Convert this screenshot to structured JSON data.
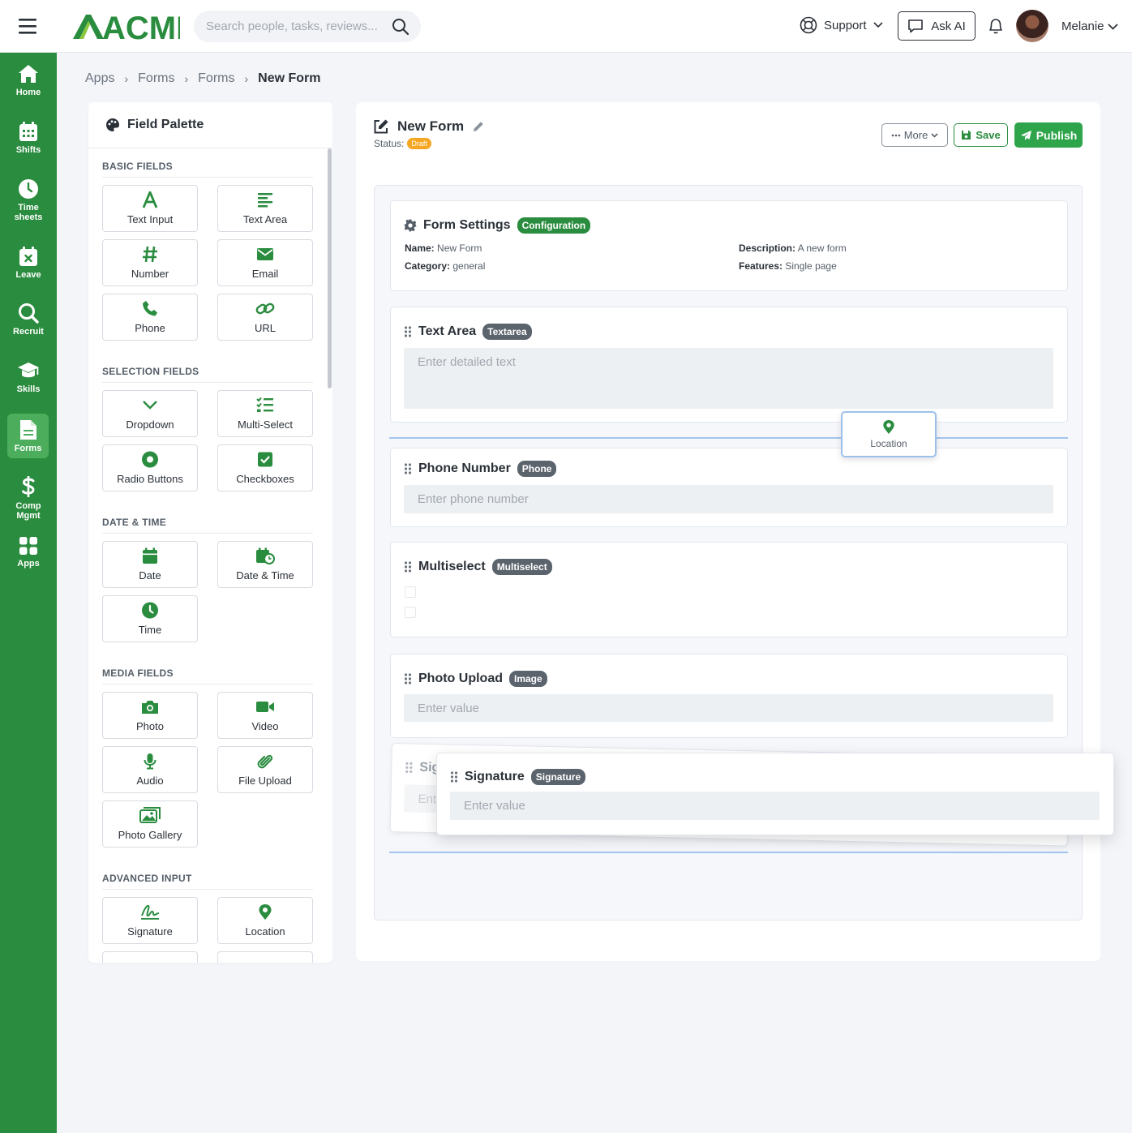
{
  "header": {
    "logo_text": "ACME",
    "search_placeholder": "Search people, tasks, reviews...",
    "support_label": "Support",
    "ask_ai_label": "Ask AI",
    "user_name": "Melanie"
  },
  "sidebar": {
    "items": [
      {
        "label": "Home",
        "icon": "home-icon"
      },
      {
        "label": "Shifts",
        "icon": "calendar-icon"
      },
      {
        "label": "Time\nsheets",
        "icon": "clock-icon"
      },
      {
        "label": "Leave",
        "icon": "calendar-x-icon"
      },
      {
        "label": "Recruit",
        "icon": "search-icon"
      },
      {
        "label": "Skills",
        "icon": "graduation-cap-icon"
      },
      {
        "label": "Forms",
        "icon": "document-icon",
        "active": true
      },
      {
        "label": "Comp\nMgmt",
        "icon": "dollar-icon"
      },
      {
        "label": "Apps",
        "icon": "apps-grid-icon"
      }
    ]
  },
  "breadcrumb": [
    "Apps",
    "Forms",
    "Forms",
    "New Form"
  ],
  "palette": {
    "title": "Field Palette",
    "sections": [
      {
        "title": "BASIC FIELDS",
        "items": [
          "Text Input",
          "Text Area",
          "Number",
          "Email",
          "Phone",
          "URL"
        ]
      },
      {
        "title": "SELECTION FIELDS",
        "items": [
          "Dropdown",
          "Multi-Select",
          "Radio Buttons",
          "Checkboxes"
        ]
      },
      {
        "title": "DATE & TIME",
        "items": [
          "Date",
          "Date & Time",
          "Time"
        ]
      },
      {
        "title": "MEDIA FIELDS",
        "items": [
          "Photo",
          "Video",
          "Audio",
          "File Upload",
          "Photo Gallery"
        ]
      },
      {
        "title": "ADVANCED INPUT",
        "items": [
          "Signature",
          "Location"
        ]
      }
    ]
  },
  "form": {
    "title": "New Form",
    "status_label": "Status:",
    "status_value": "Draft",
    "more_label": "More",
    "save_label": "Save",
    "publish_label": "Publish",
    "settings": {
      "title": "Form Settings",
      "tag": "Configuration",
      "name_label": "Name:",
      "name_value": "New Form",
      "category_label": "Category:",
      "category_value": "general",
      "description_label": "Description:",
      "description_value": "A new form",
      "features_label": "Features:",
      "features_value": "Single page"
    },
    "fields": [
      {
        "title": "Text Area",
        "tag": "Textarea",
        "placeholder": "Enter detailed text"
      },
      {
        "title": "Phone Number",
        "tag": "Phone",
        "placeholder": "Enter phone number"
      },
      {
        "title": "Multiselect",
        "tag": "Multiselect"
      },
      {
        "title": "Photo Upload",
        "tag": "Image",
        "placeholder": "Enter value"
      },
      {
        "title": "Signature",
        "tag": "Signature",
        "placeholder": "Enter value"
      }
    ],
    "drag_ghost_label": "Location"
  },
  "colors": {
    "brand": "#2a8c3e",
    "accent": "#2ea54a",
    "draft": "#f5a623"
  }
}
